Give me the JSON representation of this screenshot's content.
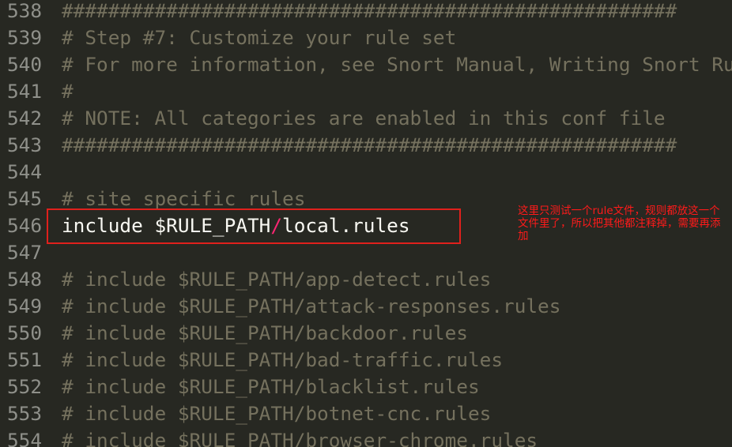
{
  "editor": {
    "lines": [
      {
        "num": "538",
        "text": "#####################################################"
      },
      {
        "num": "539",
        "text": "# Step #7: Customize your rule set"
      },
      {
        "num": "540",
        "text": "# For more information, see Snort Manual, Writing Snort Rules"
      },
      {
        "num": "541",
        "text": "#"
      },
      {
        "num": "542",
        "text": "# NOTE: All categories are enabled in this conf file"
      },
      {
        "num": "543",
        "text": "#####################################################"
      },
      {
        "num": "544",
        "text": ""
      },
      {
        "num": "545",
        "text": "# site specific rules"
      },
      {
        "num": "546",
        "before": "include $RULE_PATH",
        "slash": "/",
        "after": "local.rules"
      },
      {
        "num": "547",
        "text": ""
      },
      {
        "num": "548",
        "text": "# include $RULE_PATH/app-detect.rules"
      },
      {
        "num": "549",
        "text": "# include $RULE_PATH/attack-responses.rules"
      },
      {
        "num": "550",
        "text": "# include $RULE_PATH/backdoor.rules"
      },
      {
        "num": "551",
        "text": "# include $RULE_PATH/bad-traffic.rules"
      },
      {
        "num": "552",
        "text": "# include $RULE_PATH/blacklist.rules"
      },
      {
        "num": "553",
        "text": "# include $RULE_PATH/botnet-cnc.rules"
      },
      {
        "num": "554",
        "text": "# include $RULE_PATH/browser-chrome.rules"
      }
    ]
  },
  "annotation": {
    "text": "这里只测试一个rule文件，规则都放这一个文件里了，所以把其他都注释掉，需要再添加"
  },
  "colors": {
    "background": "#272822",
    "comment": "#75715e",
    "text": "#f8f8f2",
    "operator": "#f92672",
    "line_number": "#8f908a",
    "highlight_border": "#e0201c",
    "annotation": "#ff1a1a"
  }
}
